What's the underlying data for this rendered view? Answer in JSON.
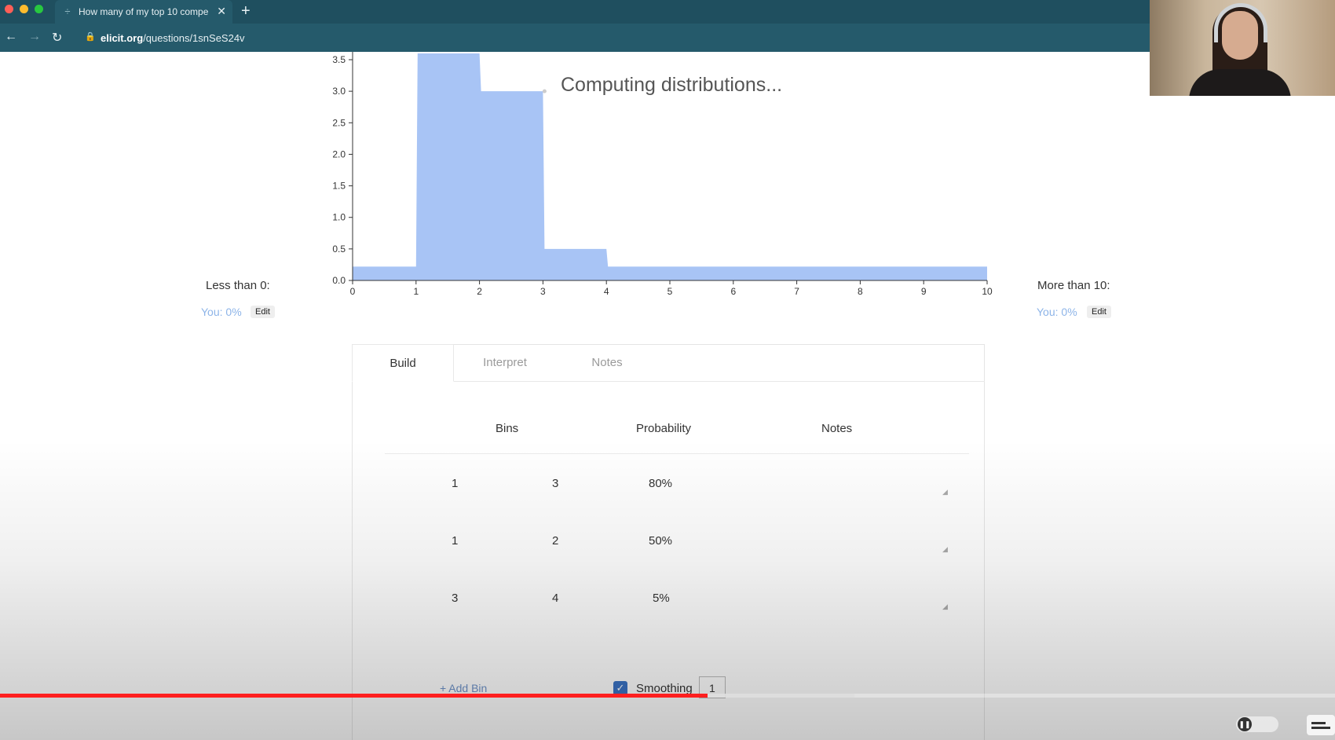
{
  "browser": {
    "tab_title": "How many of my top 10 compe",
    "url_domain": "elicit.org",
    "url_path": "/questions/1snSeS24v",
    "new_tab_icon": "plus-icon",
    "close_tab_icon": "close-icon"
  },
  "chart_data": {
    "type": "area",
    "x": [
      0,
      1,
      2,
      3,
      4,
      5,
      6,
      7,
      8,
      9,
      10
    ],
    "step_bins": [
      {
        "from": 0,
        "to": 1,
        "value": 0.22
      },
      {
        "from": 1,
        "to": 2,
        "value": 3.6
      },
      {
        "from": 2,
        "to": 3,
        "value": 3.0
      },
      {
        "from": 3,
        "to": 4,
        "value": 0.5
      },
      {
        "from": 4,
        "to": 10,
        "value": 0.22
      }
    ],
    "x_ticks": [
      "0",
      "1",
      "2",
      "3",
      "4",
      "5",
      "6",
      "7",
      "8",
      "9",
      "10"
    ],
    "y_ticks": [
      "0.0",
      "0.5",
      "1.0",
      "1.5",
      "2.0",
      "2.5",
      "3.0",
      "3.5"
    ],
    "xlim": [
      0,
      10
    ],
    "ylim": [
      0,
      3.5
    ],
    "color": "#a8c4f5",
    "annotation": "Computing distributions..."
  },
  "left_side": {
    "label": "Less than 0:",
    "you": "You: 0%",
    "edit": "Edit"
  },
  "right_side": {
    "label": "More than 10:",
    "you": "You: 0%",
    "edit": "Edit"
  },
  "tabs": [
    {
      "label": "Build",
      "active": true
    },
    {
      "label": "Interpret",
      "active": false
    },
    {
      "label": "Notes",
      "active": false
    }
  ],
  "table": {
    "headers": {
      "bins": "Bins",
      "probability": "Probability",
      "notes": "Notes"
    },
    "rows": [
      {
        "from": "1",
        "to": "3",
        "probability": "80%"
      },
      {
        "from": "1",
        "to": "2",
        "probability": "50%"
      },
      {
        "from": "3",
        "to": "4",
        "probability": "5%"
      }
    ]
  },
  "controls": {
    "add_bin": "+ Add Bin",
    "smoothing_label": "Smoothing",
    "smoothing_value": "1",
    "smoothing_checked": true
  },
  "video": {
    "played_fraction": 0.53,
    "buffered_fraction": 0.64,
    "play_icon": "pause-icon",
    "cc_icon": "captions-icon"
  }
}
